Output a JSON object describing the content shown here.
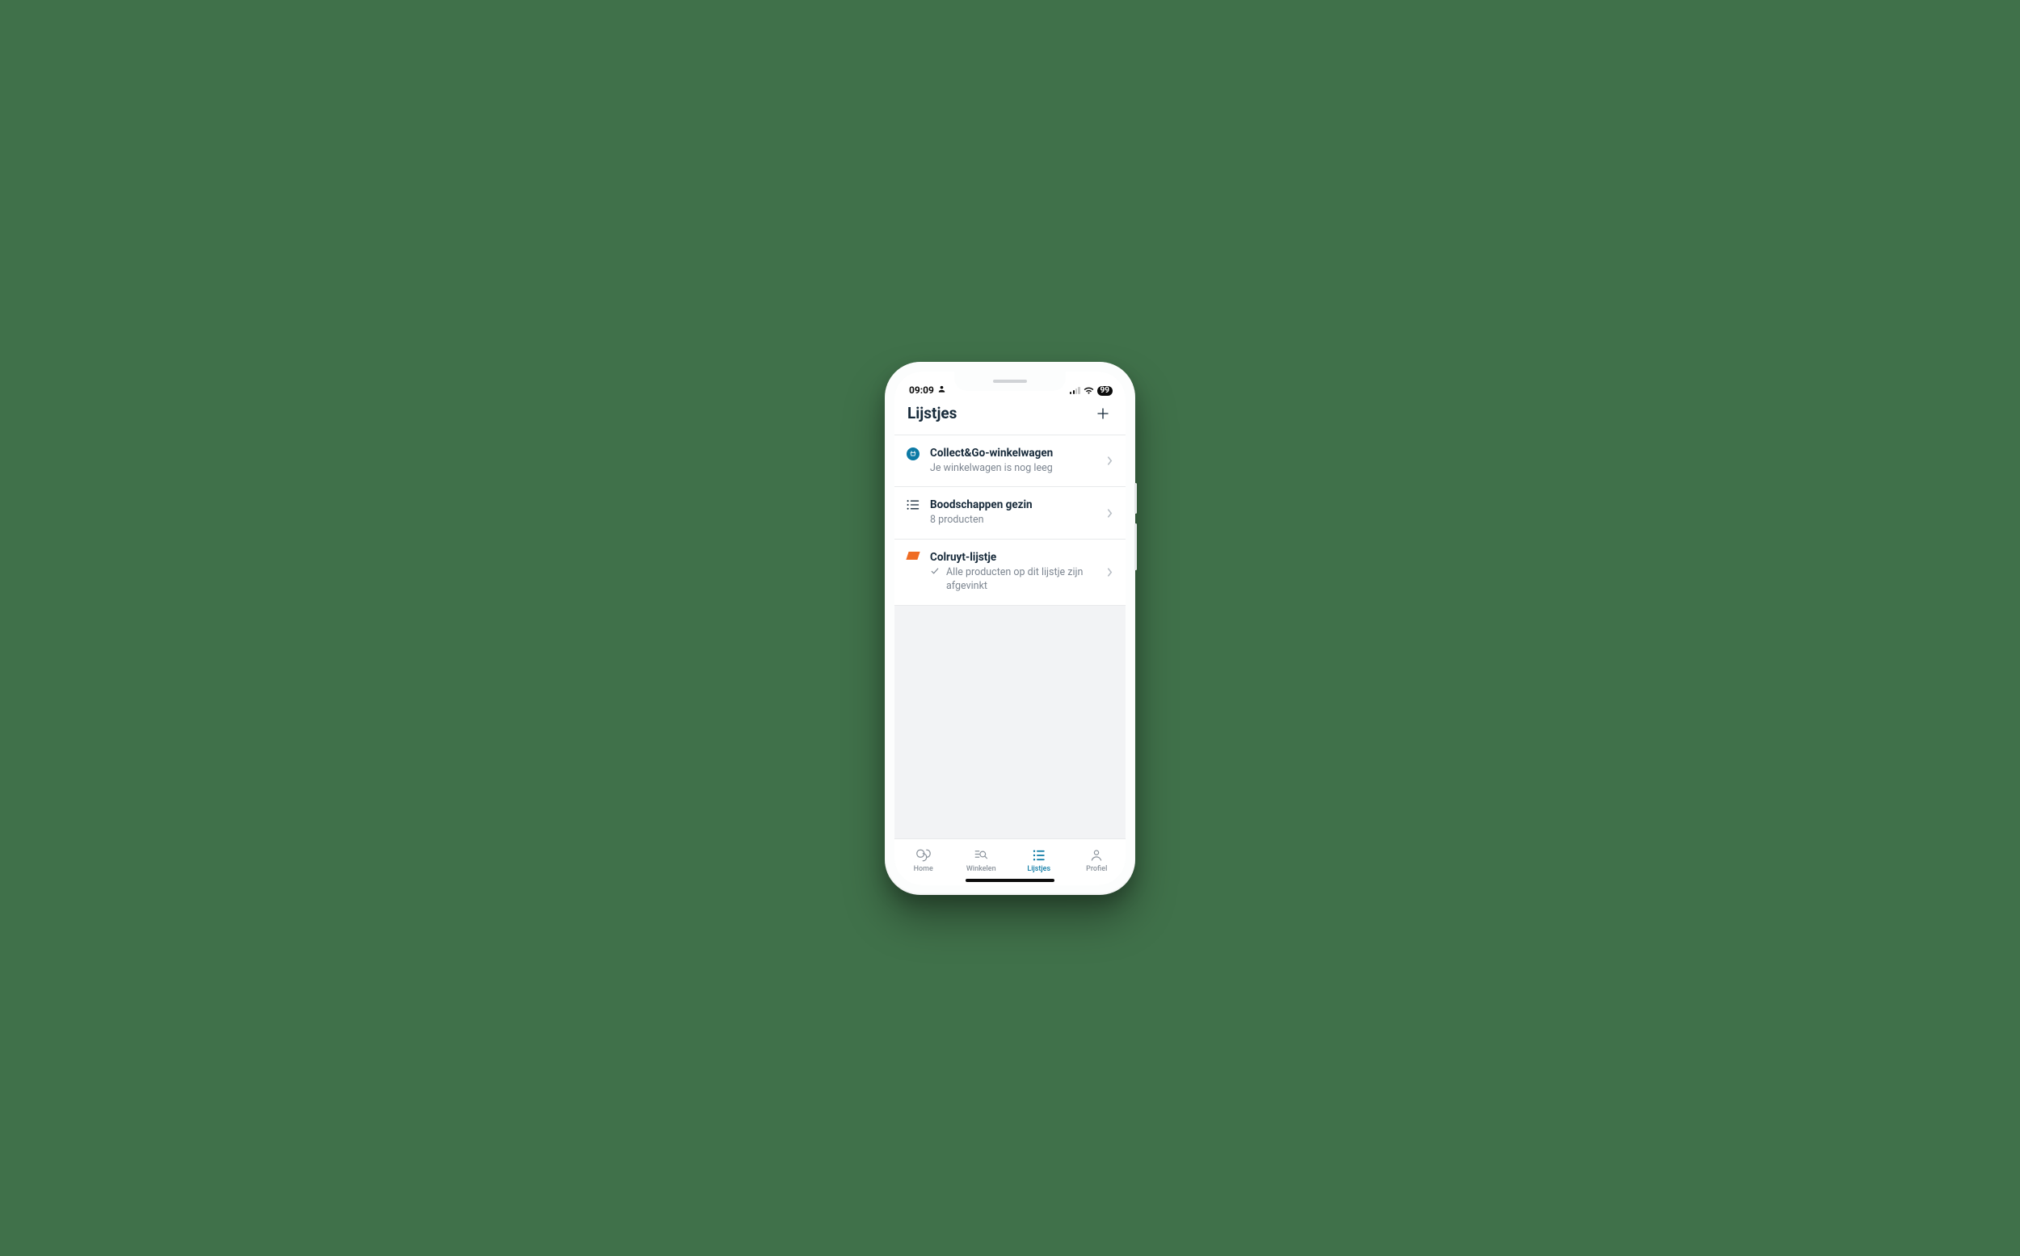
{
  "status": {
    "time": "09:09",
    "battery": "99"
  },
  "header": {
    "title": "Lijstjes"
  },
  "lists": [
    {
      "icon": "collectgo",
      "title": "Collect&Go-winkelwagen",
      "subtitle": "Je winkelwagen is nog leeg"
    },
    {
      "icon": "bullets",
      "title": "Boodschappen gezin",
      "subtitle": "8 producten"
    },
    {
      "icon": "colruyt",
      "title": "Colruyt-lijstje",
      "subtitle": "Alle producten op dit lijstje zijn afgevinkt",
      "checked": true
    }
  ],
  "tabs": {
    "home": "Home",
    "winkelen": "Winkelen",
    "lijstjes": "Lijstjes",
    "profiel": "Profiel"
  }
}
